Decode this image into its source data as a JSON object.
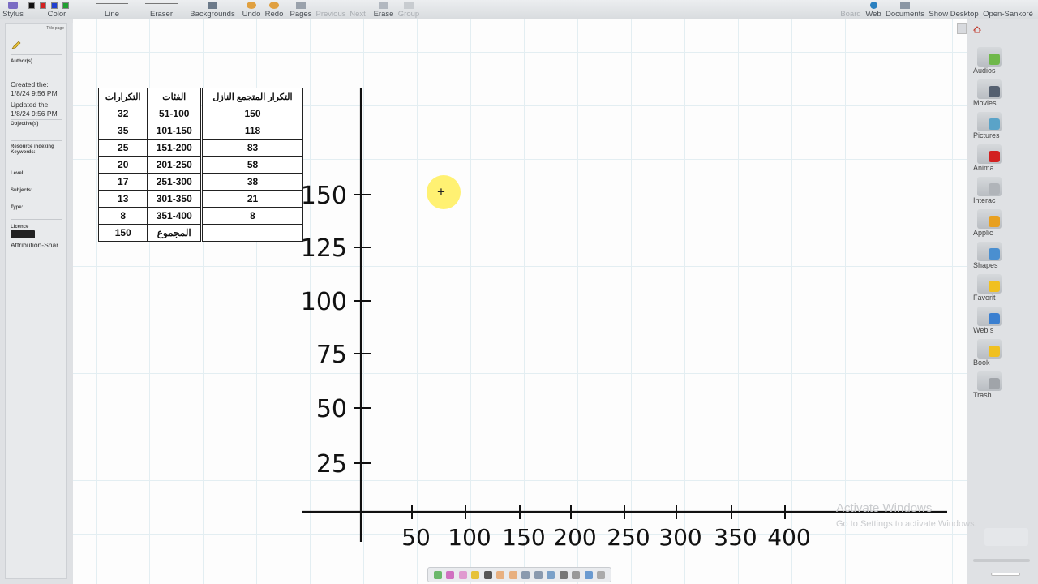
{
  "toolbar": {
    "left": [
      {
        "label": "Stylus"
      },
      {
        "label": "Color"
      },
      {
        "label": "Line"
      },
      {
        "label": "Eraser"
      },
      {
        "label": "Backgrounds"
      },
      {
        "label": "Undo"
      },
      {
        "label": "Redo"
      },
      {
        "label": "Pages"
      },
      {
        "label": "Previous",
        "disabled": true
      },
      {
        "label": "Next",
        "disabled": true
      },
      {
        "label": "Erase"
      },
      {
        "label": "Group",
        "disabled": true
      }
    ],
    "right": [
      {
        "label": "Board",
        "disabled": true
      },
      {
        "label": "Web"
      },
      {
        "label": "Documents"
      },
      {
        "label": "Show Desktop"
      },
      {
        "label": "Open-Sankoré"
      }
    ],
    "colors": [
      "#111111",
      "#d42020",
      "#2040d0",
      "#20a030"
    ]
  },
  "left_panel": {
    "title": "Title page",
    "authors_label": "Author(s)",
    "created": "Created the:",
    "created_date": "1/8/24 9:56 PM",
    "updated": "Updated the:",
    "updated_date": "1/8/24 9:56 PM",
    "objectives_label": "Objective(s)",
    "resource_label": "Resource indexing",
    "keywords_label": "Keywords:",
    "level_label": "Level:",
    "subjects_label": "Subjects:",
    "type_label": "Type:",
    "licence_label": "Licence",
    "licence_value": "Attribution-Shar"
  },
  "table1": {
    "headers": [
      "التكرارات",
      "الفئات"
    ],
    "rows": [
      [
        "32",
        "51-100"
      ],
      [
        "35",
        "101-150"
      ],
      [
        "25",
        "151-200"
      ],
      [
        "20",
        "201-250"
      ],
      [
        "17",
        "251-300"
      ],
      [
        "13",
        "301-350"
      ],
      [
        "8",
        "351-400"
      ],
      [
        "150",
        "المجموع"
      ]
    ]
  },
  "table2": {
    "header": "التكرار المتجمع النازل",
    "rows": [
      "150",
      "118",
      "83",
      "58",
      "38",
      "21",
      "8",
      ""
    ]
  },
  "graph": {
    "y_ticks": [
      "25",
      "50",
      "75",
      "100",
      "125",
      "150"
    ],
    "x_ticks": [
      "50",
      "100",
      "150",
      "200",
      "250",
      "300",
      "350",
      "400"
    ]
  },
  "right_panel": [
    {
      "label": "Audios",
      "color": "#6fb84a"
    },
    {
      "label": "Movies",
      "color": "#556070"
    },
    {
      "label": "Pictures",
      "color": "#5aa3c8"
    },
    {
      "label": "Anima",
      "color": "#d22020"
    },
    {
      "label": "Interac",
      "color": "#b0b4b9"
    },
    {
      "label": "Applic",
      "color": "#e8a020"
    },
    {
      "label": "Shapes",
      "color": "#4a8fd0"
    },
    {
      "label": "Favorit",
      "color": "#f0c020"
    },
    {
      "label": "Web s",
      "color": "#3a7fd0"
    },
    {
      "label": "Book",
      "color": "#f0c020"
    },
    {
      "label": "Trash",
      "color": "#a0a4a9"
    }
  ],
  "watermark": {
    "line1": "Activate Windows",
    "line2": "Go to Settings to activate Windows."
  }
}
